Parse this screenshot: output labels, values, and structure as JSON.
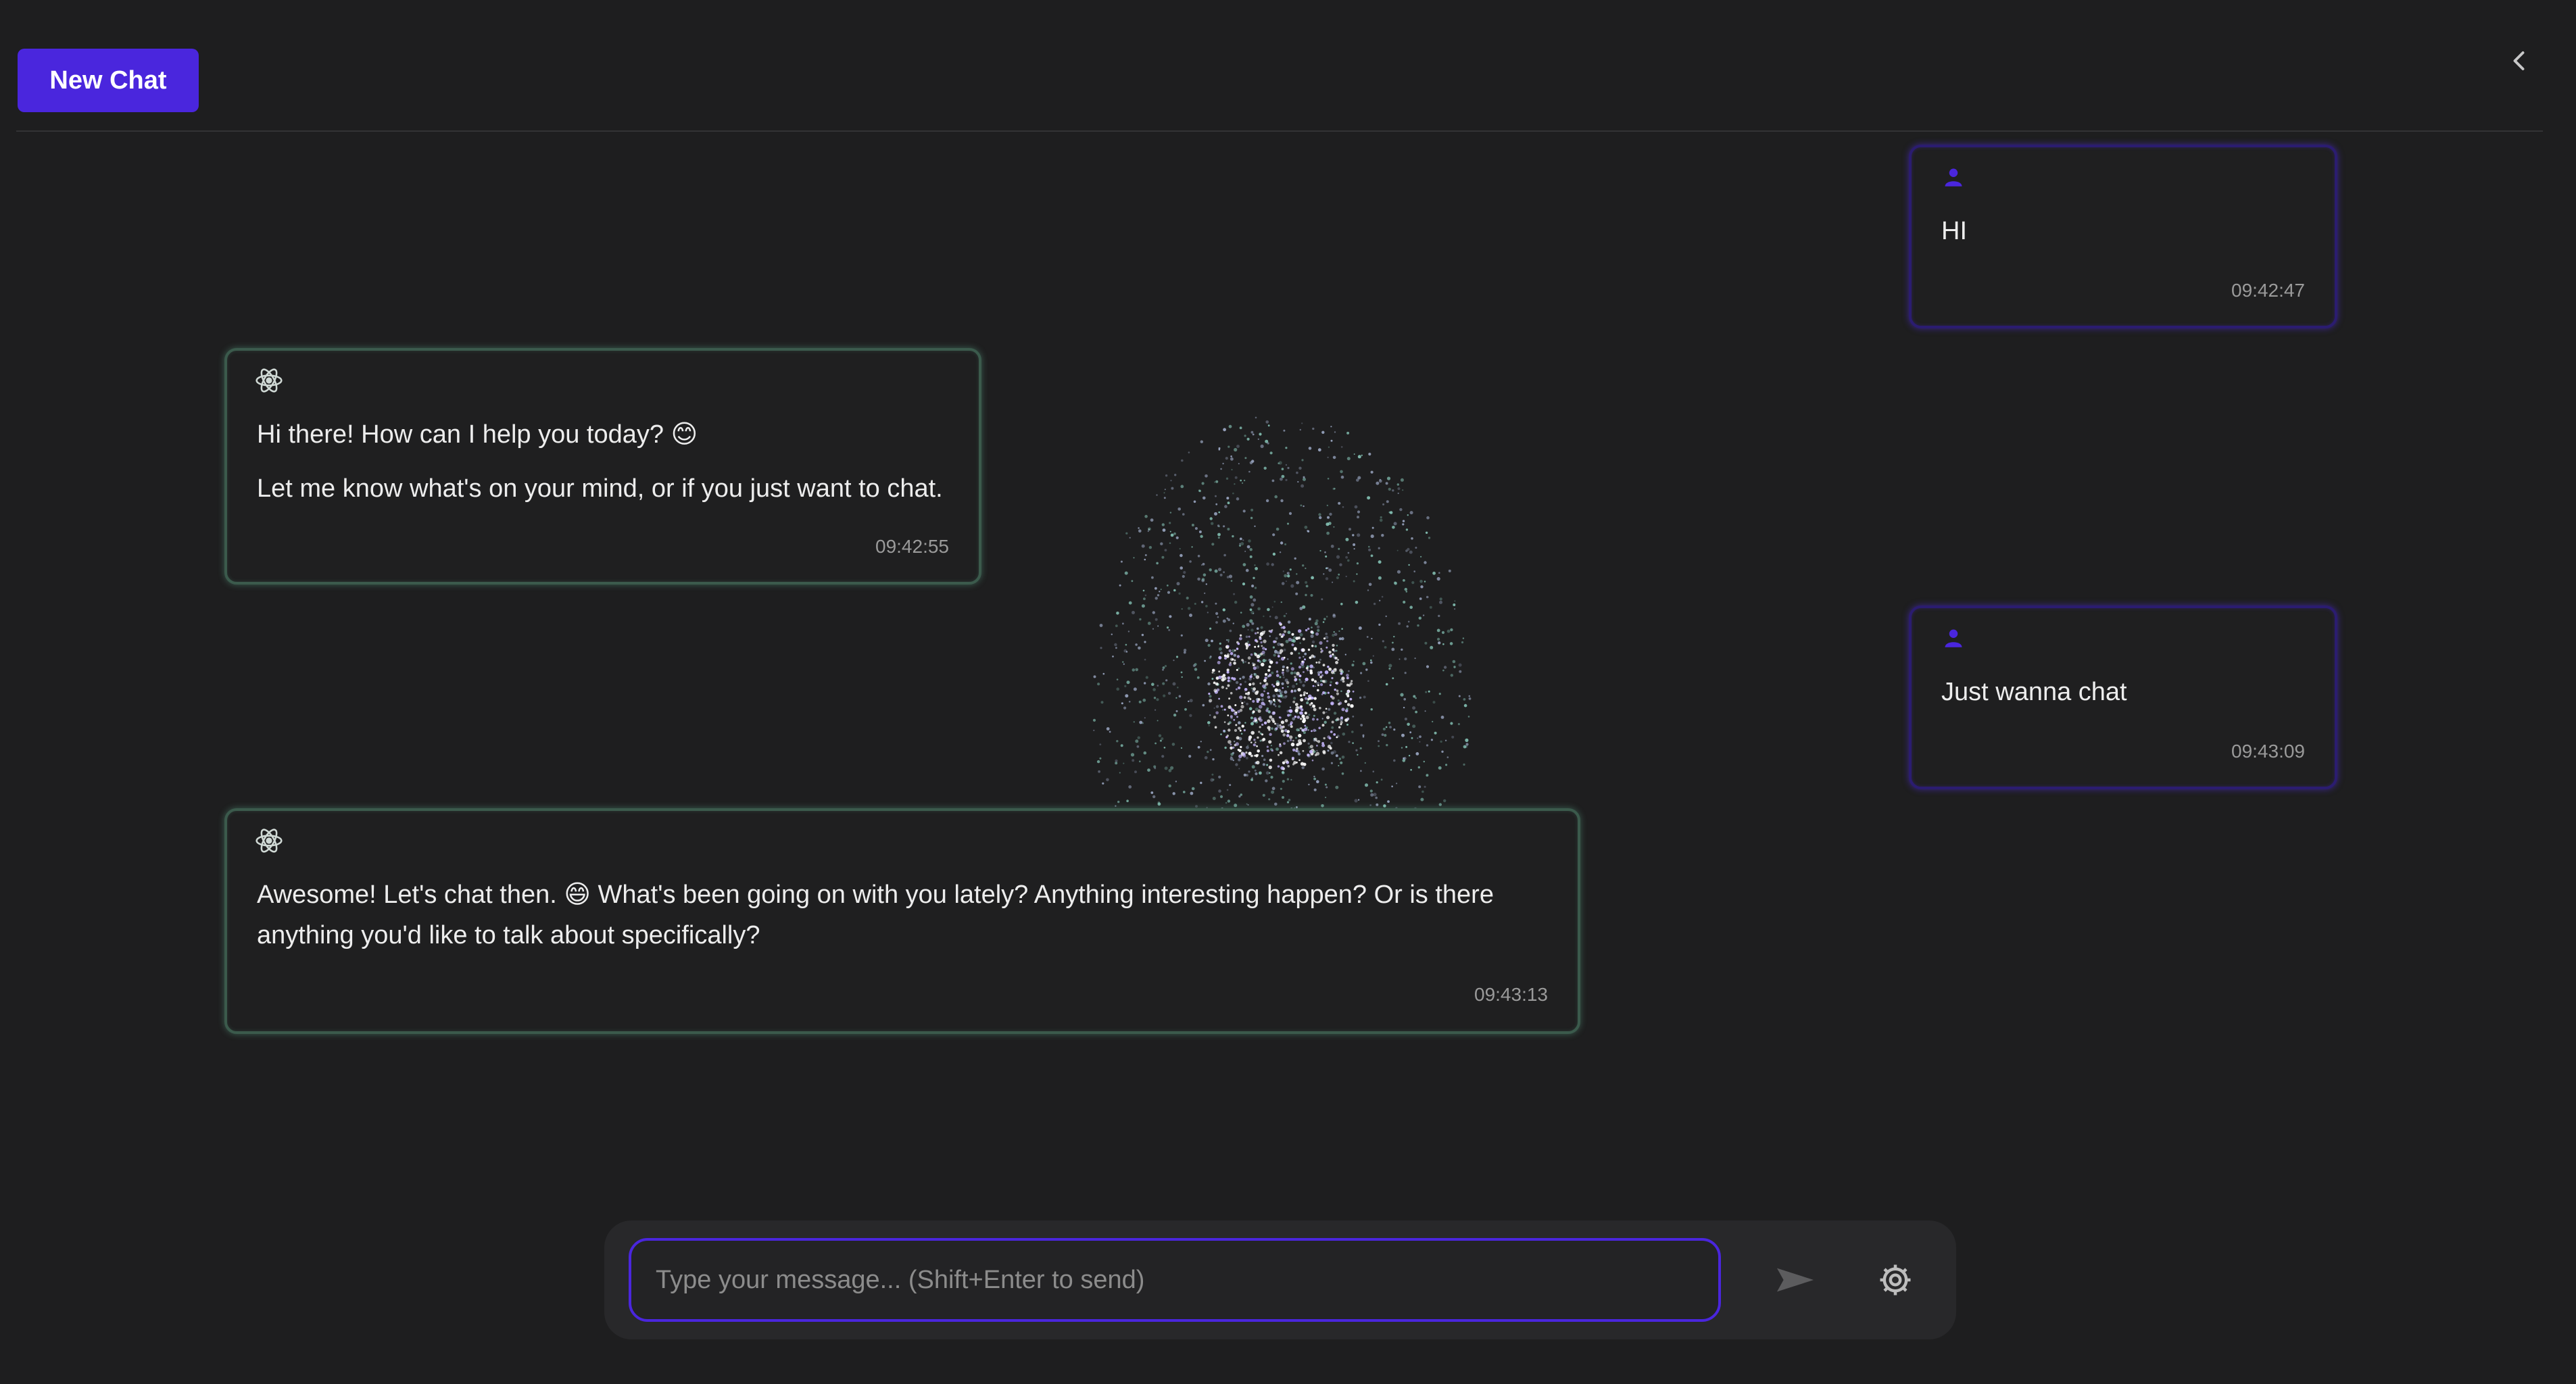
{
  "header": {
    "new_chat_label": "New Chat",
    "collapse_icon": "chevron-left-icon"
  },
  "messages": [
    {
      "role": "user",
      "icon": "user-icon",
      "paragraphs": [
        "HI"
      ],
      "time": "09:42:47"
    },
    {
      "role": "assistant",
      "icon": "atom-icon",
      "paragraphs": [
        "Hi there! How can I help you today? 😊",
        "Let me know what's on your mind, or if you just want to chat."
      ],
      "time": "09:42:55"
    },
    {
      "role": "user",
      "icon": "user-icon",
      "paragraphs": [
        "Just wanna chat"
      ],
      "time": "09:43:09"
    },
    {
      "role": "assistant",
      "icon": "atom-icon",
      "paragraphs": [
        "Awesome! Let's chat then. 😄 What's been going on with you lately? Anything interesting happen? Or is there anything you'd like to talk about specifically?"
      ],
      "time": "09:43:13"
    }
  ],
  "composer": {
    "placeholder": "Type your message... (Shift+Enter to send)",
    "value": "",
    "send_icon": "send-icon",
    "settings_icon": "gear-icon"
  },
  "colors": {
    "background": "#1e1e1f",
    "accent": "#4a26dd",
    "assistant_glow": "#60aa8c"
  }
}
